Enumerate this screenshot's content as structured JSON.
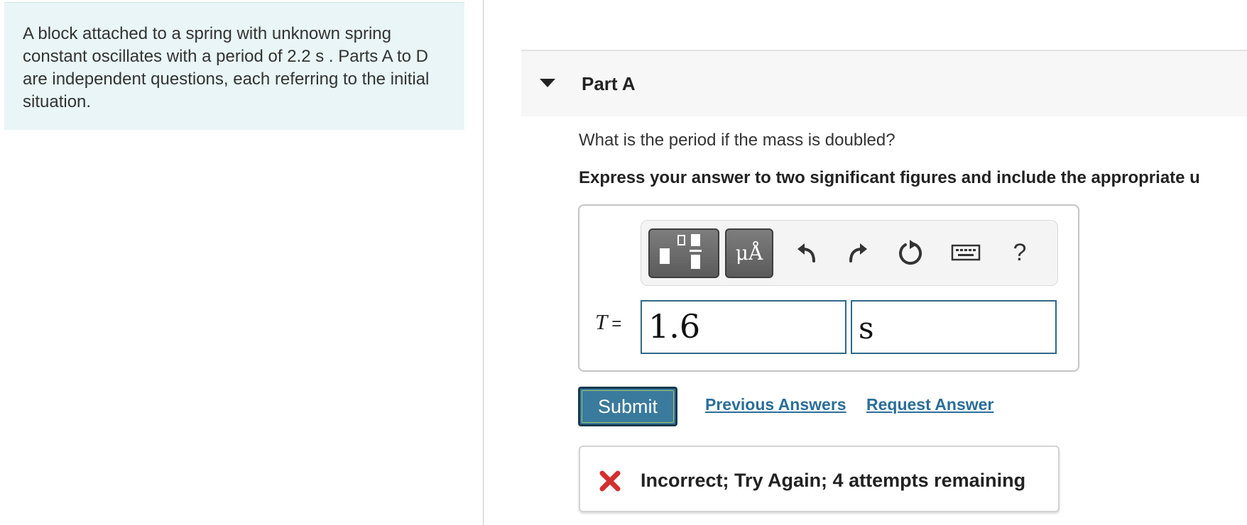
{
  "intro": {
    "text": "A block attached to a spring with unknown spring constant oscillates with a period of 2.2 s . Parts A to D are independent questions, each referring to the initial situation."
  },
  "part": {
    "title": "Part A",
    "question": "What is the period if the mass is doubled?",
    "instruction": "Express your answer to two significant figures and include the appropriate u"
  },
  "toolbar": {
    "templates_icon": "templates-icon",
    "units_label": "μÅ",
    "undo_icon": "undo-icon",
    "redo_icon": "redo-icon",
    "reset_icon": "reset-icon",
    "keyboard_icon": "keyboard-icon",
    "help_label": "?"
  },
  "answer": {
    "variable": "T",
    "equals": "=",
    "value": "1.6",
    "unit": "s"
  },
  "actions": {
    "submit_label": "Submit",
    "previous_answers_label": "Previous Answers",
    "request_answer_label": "Request Answer"
  },
  "feedback": {
    "icon": "x-icon",
    "message": "Incorrect; Try Again; 4 attempts remaining",
    "color": "#d32f2f"
  },
  "colors": {
    "intro_bg": "#e9f5f6",
    "accent": "#2b6e99",
    "submit_bg": "#3a7a9c"
  }
}
